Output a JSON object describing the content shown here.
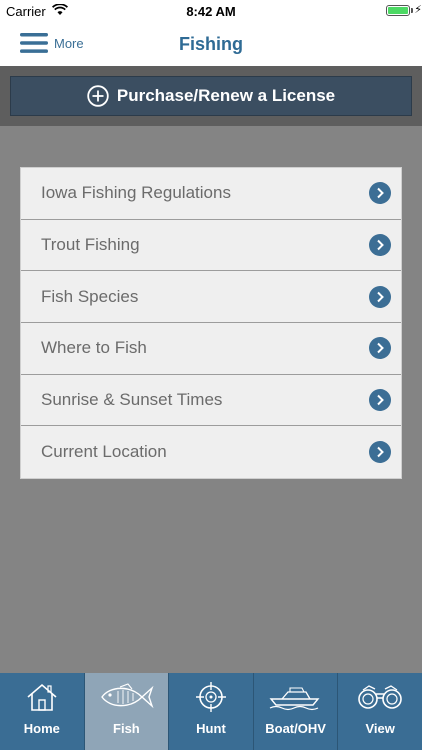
{
  "status_bar": {
    "carrier": "Carrier",
    "time": "8:42 AM"
  },
  "nav": {
    "more_label": "More",
    "title": "Fishing"
  },
  "license": {
    "label": "Purchase/Renew a License"
  },
  "menu": {
    "items": [
      {
        "label": "Iowa Fishing Regulations"
      },
      {
        "label": "Trout Fishing"
      },
      {
        "label": "Fish Species"
      },
      {
        "label": "Where to Fish"
      },
      {
        "label": "Sunrise & Sunset Times"
      },
      {
        "label": "Current Location"
      }
    ]
  },
  "tabs": [
    {
      "label": "Home",
      "icon": "house-icon",
      "active": false
    },
    {
      "label": "Fish",
      "icon": "fish-icon",
      "active": true
    },
    {
      "label": "Hunt",
      "icon": "crosshair-icon",
      "active": false
    },
    {
      "label": "Boat/OHV",
      "icon": "boat-icon",
      "active": false
    },
    {
      "label": "View",
      "icon": "binoculars-icon",
      "active": false
    }
  ],
  "colors": {
    "accent": "#2f6b95",
    "tab_bar": "#3a6d94",
    "tab_active": "#8fa5b7",
    "license_button": "#3b4e61"
  }
}
